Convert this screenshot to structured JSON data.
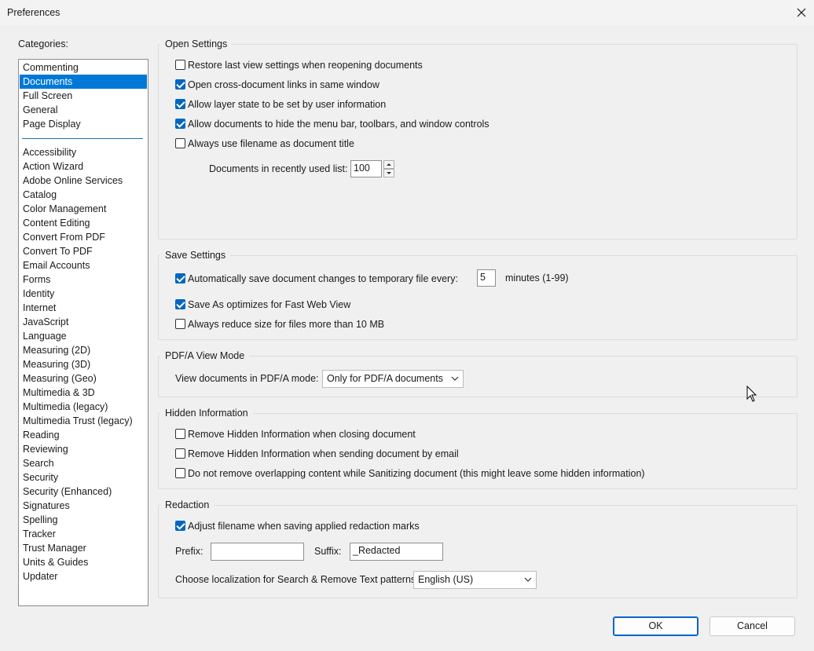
{
  "window": {
    "title": "Preferences"
  },
  "categories": {
    "label": "Categories:",
    "group_top": [
      "Commenting",
      "Documents",
      "Full Screen",
      "General",
      "Page Display"
    ],
    "group_bottom": [
      "Accessibility",
      "Action Wizard",
      "Adobe Online Services",
      "Catalog",
      "Color Management",
      "Content Editing",
      "Convert From PDF",
      "Convert To PDF",
      "Email Accounts",
      "Forms",
      "Identity",
      "Internet",
      "JavaScript",
      "Language",
      "Measuring (2D)",
      "Measuring (3D)",
      "Measuring (Geo)",
      "Multimedia & 3D",
      "Multimedia (legacy)",
      "Multimedia Trust (legacy)",
      "Reading",
      "Reviewing",
      "Search",
      "Security",
      "Security (Enhanced)",
      "Signatures",
      "Spelling",
      "Tracker",
      "Trust Manager",
      "Units & Guides",
      "Updater"
    ],
    "selected": "Documents"
  },
  "open_settings": {
    "title": "Open Settings",
    "options": [
      {
        "label": "Restore last view settings when reopening documents",
        "checked": false
      },
      {
        "label": "Open cross-document links in same window",
        "checked": true
      },
      {
        "label": "Allow layer state to be set by user information",
        "checked": true
      },
      {
        "label": "Allow documents to hide the menu bar, toolbars, and window controls",
        "checked": true
      },
      {
        "label": "Always use filename as document title",
        "checked": false
      }
    ],
    "recent_label": "Documents in recently used list:",
    "recent_value": "100"
  },
  "save_settings": {
    "title": "Save Settings",
    "autosave_label": "Automatically save document changes to temporary file every:",
    "autosave_checked": true,
    "autosave_value": "5",
    "autosave_units": "minutes (1-99)",
    "options": [
      {
        "label": "Save As optimizes for Fast Web View",
        "checked": true
      },
      {
        "label": "Always reduce size for files more than 10 MB",
        "checked": false
      }
    ]
  },
  "pdfa": {
    "title": "PDF/A View Mode",
    "label": "View documents in PDF/A mode:",
    "value": "Only for PDF/A documents"
  },
  "hidden_info": {
    "title": "Hidden Information",
    "options": [
      {
        "label": "Remove Hidden Information when closing document",
        "checked": false
      },
      {
        "label": "Remove Hidden Information when sending document by email",
        "checked": false
      },
      {
        "label": "Do not remove overlapping content while Sanitizing document (this might leave some hidden information)",
        "checked": false
      }
    ]
  },
  "redaction": {
    "title": "Redaction",
    "adjust_label": "Adjust filename when saving applied redaction marks",
    "adjust_checked": true,
    "prefix_label": "Prefix:",
    "prefix_value": "",
    "suffix_label": "Suffix:",
    "suffix_value": "_Redacted",
    "localization_label": "Choose localization for Search & Remove Text patterns:",
    "localization_value": "English (US)"
  },
  "buttons": {
    "ok": "OK",
    "cancel": "Cancel"
  },
  "colors": {
    "accent": "#0067c0",
    "selection": "#0078d7"
  }
}
